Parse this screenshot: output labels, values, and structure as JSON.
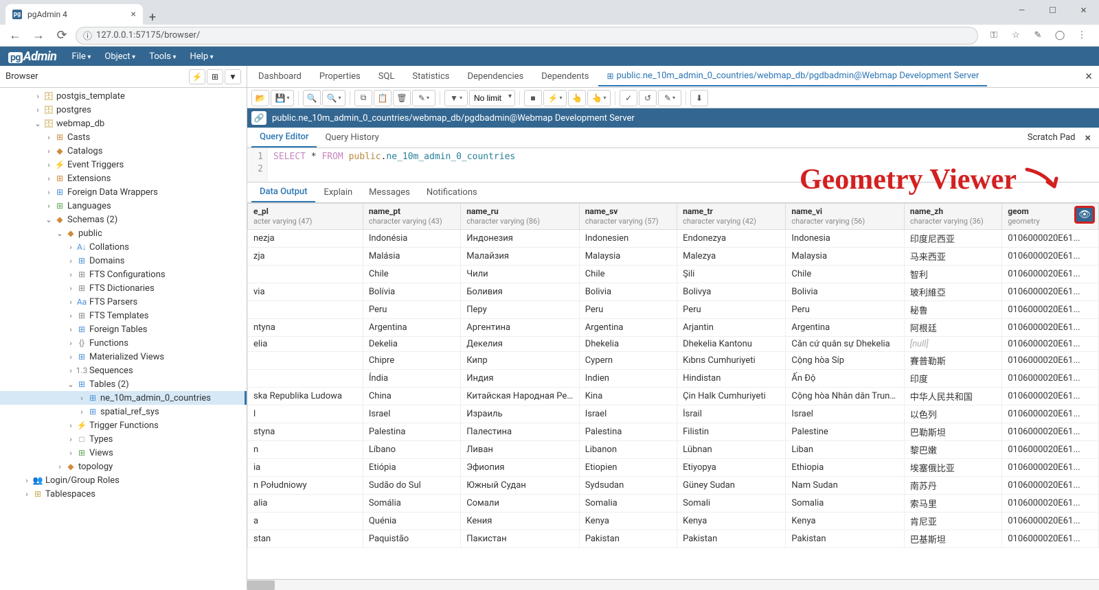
{
  "browser": {
    "tab_title": "pgAdmin 4",
    "url": "127.0.0.1:57175/browser/"
  },
  "menubar": {
    "logo": "Admin",
    "items": [
      "File",
      "Object",
      "Tools",
      "Help"
    ]
  },
  "sidebar": {
    "title": "Browser"
  },
  "tree": [
    {
      "d": 3,
      "t": "›",
      "i": "🗄",
      "ic": "",
      "l": "postgis_template"
    },
    {
      "d": 3,
      "t": "›",
      "i": "🗄",
      "ic": "",
      "l": "postgres"
    },
    {
      "d": 3,
      "t": "⌄",
      "i": "🗄",
      "ic": "",
      "l": "webmap_db"
    },
    {
      "d": 4,
      "t": "›",
      "i": "⊞",
      "ic": "orange",
      "l": "Casts"
    },
    {
      "d": 4,
      "t": "›",
      "i": "◆",
      "ic": "orange",
      "l": "Catalogs"
    },
    {
      "d": 4,
      "t": "›",
      "i": "⚡",
      "ic": "blue",
      "l": "Event Triggers"
    },
    {
      "d": 4,
      "t": "›",
      "i": "⊞",
      "ic": "orange",
      "l": "Extensions"
    },
    {
      "d": 4,
      "t": "›",
      "i": "⊞",
      "ic": "blue",
      "l": "Foreign Data Wrappers"
    },
    {
      "d": 4,
      "t": "›",
      "i": "⊞",
      "ic": "green",
      "l": "Languages"
    },
    {
      "d": 4,
      "t": "⌄",
      "i": "◆",
      "ic": "orange",
      "l": "Schemas (2)"
    },
    {
      "d": 5,
      "t": "⌄",
      "i": "◆",
      "ic": "orange",
      "l": "public"
    },
    {
      "d": 6,
      "t": "›",
      "i": "A↓",
      "ic": "blue",
      "l": "Collations"
    },
    {
      "d": 6,
      "t": "›",
      "i": "⊞",
      "ic": "blue",
      "l": "Domains"
    },
    {
      "d": 6,
      "t": "›",
      "i": "⊞",
      "ic": "gray",
      "l": "FTS Configurations"
    },
    {
      "d": 6,
      "t": "›",
      "i": "⊞",
      "ic": "gray",
      "l": "FTS Dictionaries"
    },
    {
      "d": 6,
      "t": "›",
      "i": "Aa",
      "ic": "blue",
      "l": "FTS Parsers"
    },
    {
      "d": 6,
      "t": "›",
      "i": "⊞",
      "ic": "gray",
      "l": "FTS Templates"
    },
    {
      "d": 6,
      "t": "›",
      "i": "⊞",
      "ic": "blue",
      "l": "Foreign Tables"
    },
    {
      "d": 6,
      "t": "›",
      "i": "{}",
      "ic": "gray",
      "l": "Functions"
    },
    {
      "d": 6,
      "t": "›",
      "i": "⊞",
      "ic": "blue",
      "l": "Materialized Views"
    },
    {
      "d": 6,
      "t": "›",
      "i": "1.3",
      "ic": "gray",
      "l": "Sequences"
    },
    {
      "d": 6,
      "t": "⌄",
      "i": "⊞",
      "ic": "blue",
      "l": "Tables (2)"
    },
    {
      "d": 7,
      "t": "›",
      "i": "⊞",
      "ic": "blue",
      "l": "ne_10m_admin_0_countries",
      "sel": true
    },
    {
      "d": 7,
      "t": "›",
      "i": "⊞",
      "ic": "blue",
      "l": "spatial_ref_sys"
    },
    {
      "d": 6,
      "t": "›",
      "i": "⚡",
      "ic": "orange",
      "l": "Trigger Functions"
    },
    {
      "d": 6,
      "t": "›",
      "i": "□",
      "ic": "gray",
      "l": "Types"
    },
    {
      "d": 6,
      "t": "›",
      "i": "⊞",
      "ic": "green",
      "l": "Views"
    },
    {
      "d": 5,
      "t": "›",
      "i": "◆",
      "ic": "orange",
      "l": "topology"
    },
    {
      "d": 2,
      "t": "›",
      "i": "👥",
      "ic": "orange",
      "l": "Login/Group Roles"
    },
    {
      "d": 2,
      "t": "›",
      "i": "⊞",
      "ic": "",
      "l": "Tablespaces"
    }
  ],
  "main_tabs": {
    "items": [
      "Dashboard",
      "Properties",
      "SQL",
      "Statistics",
      "Dependencies",
      "Dependents"
    ],
    "active": "public.ne_10m_admin_0_countries/webmap_db/pgdbadmin@Webmap Development Server"
  },
  "toolbar": {
    "no_limit": "No limit"
  },
  "context": "public.ne_10m_admin_0_countries/webmap_db/pgdbadmin@Webmap Development Server",
  "sub_tabs": {
    "items": [
      "Query Editor",
      "Query History"
    ],
    "scratch": "Scratch Pad"
  },
  "sql": {
    "line1": "1",
    "line2": "2",
    "code_select": "SELECT",
    "code_star": " * ",
    "code_from": "FROM",
    "code_schema": " public",
    "code_dot": ".",
    "code_table": "ne_10m_admin_0_countries"
  },
  "result_tabs": [
    "Data Output",
    "Explain",
    "Messages",
    "Notifications"
  ],
  "columns": [
    {
      "name": "e_pl",
      "type": "acter varying (47)"
    },
    {
      "name": "name_pt",
      "type": "character varying (43)"
    },
    {
      "name": "name_ru",
      "type": "character varying (86)"
    },
    {
      "name": "name_sv",
      "type": "character varying (57)"
    },
    {
      "name": "name_tr",
      "type": "character varying (42)"
    },
    {
      "name": "name_vi",
      "type": "character varying (56)"
    },
    {
      "name": "name_zh",
      "type": "character varying (36)"
    },
    {
      "name": "geom",
      "type": "geometry"
    }
  ],
  "rows": [
    [
      "nezja",
      "Indonésia",
      "Индонезия",
      "Indonesien",
      "Endonezya",
      "Indonesia",
      "印度尼西亚",
      "0106000020E61..."
    ],
    [
      "zja",
      "Malásia",
      "Малайзия",
      "Malaysia",
      "Malezya",
      "Malaysia",
      "马来西亚",
      "0106000020E61..."
    ],
    [
      "",
      "Chile",
      "Чили",
      "Chile",
      "Şili",
      "Chile",
      "智利",
      "0106000020E61..."
    ],
    [
      "via",
      "Bolívia",
      "Боливия",
      "Bolivia",
      "Bolivya",
      "Bolivia",
      "玻利維亞",
      "0106000020E61..."
    ],
    [
      "",
      "Peru",
      "Перу",
      "Peru",
      "Peru",
      "Peru",
      "秘鲁",
      "0106000020E61..."
    ],
    [
      "ntyna",
      "Argentina",
      "Аргентина",
      "Argentina",
      "Arjantin",
      "Argentina",
      "阿根廷",
      "0106000020E61..."
    ],
    [
      "elia",
      "Dekelia",
      "Декелия",
      "Dhekelia",
      "Dhekelia Kantonu",
      "Căn cứ quân sự Dhekelia",
      "[null]",
      "0106000020E61..."
    ],
    [
      "",
      "Chipre",
      "Кипр",
      "Cypern",
      "Kıbrıs Cumhuriyeti",
      "Cộng hòa Síp",
      "賽普勒斯",
      "0106000020E61..."
    ],
    [
      "",
      "Índia",
      "Индия",
      "Indien",
      "Hindistan",
      "Ấn Độ",
      "印度",
      "0106000020E61..."
    ],
    [
      "ska Republika Ludowa",
      "China",
      "Китайская Народная Ре...",
      "Kina",
      "Çin Halk Cumhuriyeti",
      "Cộng hòa Nhân dân Trung...",
      "中华人民共和国",
      "0106000020E61..."
    ],
    [
      "l",
      "Israel",
      "Израиль",
      "Israel",
      "İsrail",
      "Israel",
      "以色列",
      "0106000020E61..."
    ],
    [
      "styna",
      "Palestina",
      "Палестина",
      "Palestina",
      "Filistin",
      "Palestine",
      "巴勒斯坦",
      "0106000020E61..."
    ],
    [
      "n",
      "Líbano",
      "Ливан",
      "Libanon",
      "Lübnan",
      "Liban",
      "黎巴嫩",
      "0106000020E61..."
    ],
    [
      "ia",
      "Etiópia",
      "Эфиопия",
      "Etiopien",
      "Etiyopya",
      "Ethiopia",
      "埃塞俄比亚",
      "0106000020E61..."
    ],
    [
      "n Południowy",
      "Sudão do Sul",
      "Южный Судан",
      "Sydsudan",
      "Güney Sudan",
      "Nam Sudan",
      "南苏丹",
      "0106000020E61..."
    ],
    [
      "alia",
      "Somália",
      "Сомали",
      "Somalia",
      "Somali",
      "Somalia",
      "索马里",
      "0106000020E61..."
    ],
    [
      "a",
      "Quénia",
      "Кения",
      "Kenya",
      "Kenya",
      "Kenya",
      "肯尼亚",
      "0106000020E61..."
    ],
    [
      "stan",
      "Paquistão",
      "Пакистан",
      "Pakistan",
      "Pakistan",
      "Pakistan",
      "巴基斯坦",
      "0106000020E61..."
    ]
  ],
  "annotation": "Geometry Viewer"
}
